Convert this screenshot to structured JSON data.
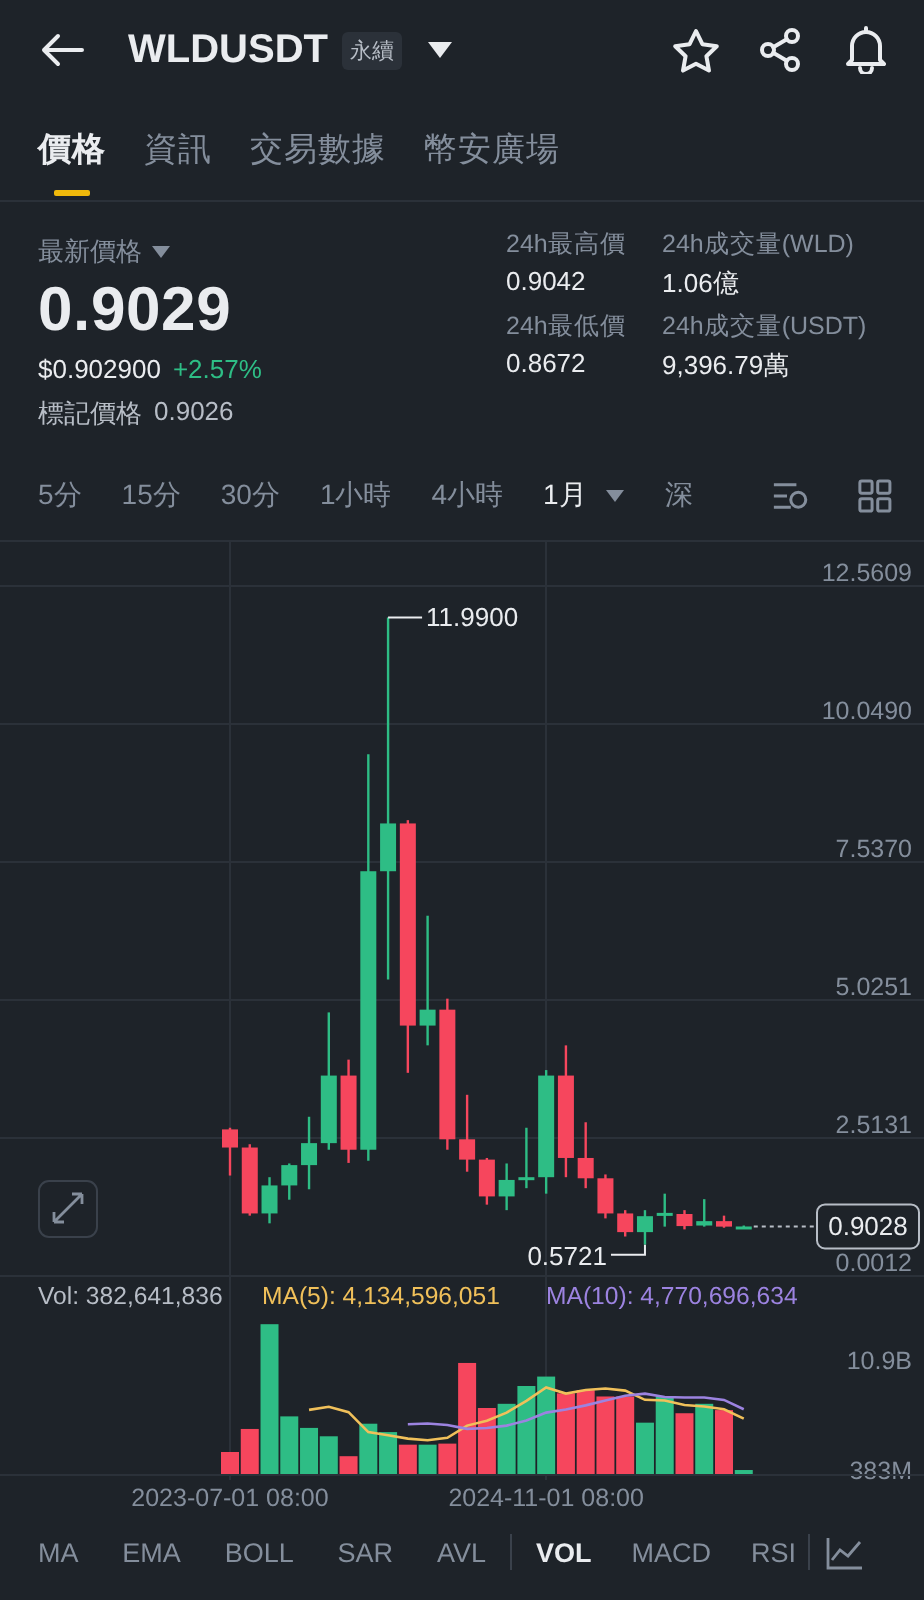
{
  "header": {
    "symbol": "WLDUSDT",
    "badge": "永續"
  },
  "tabs": [
    {
      "label": "價格",
      "selected": true
    },
    {
      "label": "資訊",
      "selected": false
    },
    {
      "label": "交易數據",
      "selected": false
    },
    {
      "label": "幣安廣場",
      "selected": false
    }
  ],
  "price": {
    "label": "最新價格",
    "last": "0.9029",
    "usd": "$0.902900",
    "change": "+2.57%",
    "rising": true,
    "mark_label": "標記價格",
    "mark": "0.9026"
  },
  "stats": [
    {
      "label": "24h最高價",
      "value": "0.9042"
    },
    {
      "label": "24h成交量(WLD)",
      "value": "1.06億"
    },
    {
      "label": "24h最低價",
      "value": "0.8672"
    },
    {
      "label": "24h成交量(USDT)",
      "value": "9,396.79萬"
    }
  ],
  "intervals": [
    {
      "label": "5分",
      "kind": "option",
      "selected": false
    },
    {
      "label": "15分",
      "kind": "option",
      "selected": false
    },
    {
      "label": "30分",
      "kind": "option",
      "selected": false
    },
    {
      "label": "1小時",
      "kind": "option",
      "selected": false
    },
    {
      "label": "4小時",
      "kind": "option",
      "selected": false
    },
    {
      "label": "1月",
      "kind": "dropdown",
      "selected": true
    },
    {
      "label": "深",
      "kind": "option",
      "selected": false
    }
  ],
  "price_chart": {
    "chart_data": {
      "type": "candlestick",
      "grid": true,
      "ylim": [
        0.0012,
        13.4
      ],
      "yticks": [
        {
          "value": 12.5609,
          "label": "12.5609"
        },
        {
          "value": 10.049,
          "label": "10.0490"
        },
        {
          "value": 7.537,
          "label": "7.5370"
        },
        {
          "value": 5.0251,
          "label": "5.0251"
        },
        {
          "value": 2.5131,
          "label": "2.5131"
        },
        {
          "value": 0.0012,
          "label": "0.0012"
        }
      ],
      "categories": [
        null,
        null,
        null,
        null,
        null,
        null,
        null,
        null,
        null,
        null,
        null,
        null,
        null,
        null,
        null,
        null,
        null,
        null,
        null,
        null,
        null,
        null,
        null,
        null,
        null,
        null,
        null
      ],
      "ohlc": [
        [
          2.67,
          2.7,
          1.83,
          2.34
        ],
        [
          2.34,
          2.4,
          1.1,
          1.14
        ],
        [
          1.14,
          1.8,
          0.96,
          1.65
        ],
        [
          1.65,
          2.05,
          1.39,
          2.02
        ],
        [
          2.02,
          2.9,
          1.58,
          2.42
        ],
        [
          2.42,
          4.8,
          2.3,
          3.65
        ],
        [
          3.65,
          3.94,
          2.06,
          2.3
        ],
        [
          2.3,
          9.5,
          2.1,
          7.37
        ],
        [
          7.37,
          11.99,
          5.4,
          8.24
        ],
        [
          8.24,
          8.3,
          3.7,
          4.56
        ],
        [
          4.56,
          6.56,
          4.2,
          4.85
        ],
        [
          4.85,
          5.05,
          2.3,
          2.49
        ],
        [
          2.49,
          3.3,
          1.9,
          2.12
        ],
        [
          2.12,
          2.15,
          1.3,
          1.45
        ],
        [
          1.45,
          2.05,
          1.2,
          1.75
        ],
        [
          1.75,
          2.7,
          1.6,
          1.8
        ],
        [
          1.8,
          3.75,
          1.5,
          3.65
        ],
        [
          3.65,
          4.2,
          1.8,
          2.15
        ],
        [
          2.15,
          2.8,
          1.6,
          1.78
        ],
        [
          1.78,
          1.85,
          1.05,
          1.14
        ],
        [
          1.14,
          1.2,
          0.72,
          0.8
        ],
        [
          0.8,
          1.2,
          0.5721,
          1.09
        ],
        [
          1.1,
          1.5,
          0.9,
          1.15
        ],
        [
          1.13,
          1.2,
          0.85,
          0.91
        ],
        [
          0.92,
          1.4,
          0.9,
          1.0
        ],
        [
          1.0,
          1.1,
          0.88,
          0.9
        ],
        [
          0.88,
          0.92,
          0.86,
          0.9028
        ]
      ],
      "annotations": [
        {
          "text": "11.9900"
        },
        {
          "text": "0.5721"
        }
      ],
      "ref_lines": [
        {
          "label": "0.9028"
        }
      ]
    }
  },
  "volume_chart": {
    "chart_data": {
      "type": "bar",
      "ylim": [
        0,
        18900000000
      ],
      "yticks": [
        {
          "value": 10900000000,
          "label": "10.9B"
        },
        {
          "value": 383000000,
          "label": "383M"
        }
      ],
      "categories": [
        "2023-07-01 08:00",
        null,
        null,
        null,
        null,
        null,
        null,
        null,
        null,
        null,
        null,
        null,
        null,
        null,
        null,
        null,
        "2024-11-01 08:00",
        null,
        null,
        null,
        null,
        null,
        null,
        null,
        null,
        null,
        null
      ],
      "series": [
        {
          "name": "Vol: 382,641,836",
          "colors": [
            "#f6465d",
            "#f6465d",
            "#2ebd85",
            "#2ebd85",
            "#2ebd85",
            "#2ebd85",
            "#f6465d",
            "#2ebd85",
            "#2ebd85",
            "#f6465d",
            "#2ebd85",
            "#f6465d",
            "#f6465d",
            "#f6465d",
            "#2ebd85",
            "#2ebd85",
            "#2ebd85",
            "#f6465d",
            "#f6465d",
            "#f6465d",
            "#f6465d",
            "#2ebd85",
            "#2ebd85",
            "#f6465d",
            "#2ebd85",
            "#f6465d",
            "#2ebd85"
          ],
          "values": [
            2100000000,
            4300000000,
            14300000000,
            5500000000,
            4400000000,
            3600000000,
            1700000000,
            4800000000,
            4000000000,
            2800000000,
            2800000000,
            2900000000,
            10600000000,
            6300000000,
            6700000000,
            8400000000,
            9300000000,
            7700000000,
            8000000000,
            7400000000,
            7400000000,
            4900000000,
            7400000000,
            5800000000,
            6700000000,
            6100000000,
            380000000
          ]
        },
        {
          "name": "MA(5): 4,134,596,051",
          "type": "line",
          "color": "#f0c05a",
          "values": [
            null,
            null,
            null,
            null,
            6120000000,
            6420000000,
            5900000000,
            4000000000,
            3700000000,
            3380000000,
            3220000000,
            3460000000,
            4620000000,
            5080000000,
            5860000000,
            6980000000,
            8260000000,
            7680000000,
            8020000000,
            8160000000,
            7960000000,
            7080000000,
            7020000000,
            6580000000,
            6440000000,
            6180000000,
            5280000000
          ]
        },
        {
          "name": "MA(10): 4,770,696,634",
          "type": "line",
          "color": "#9c83e0",
          "values": [
            null,
            null,
            null,
            null,
            null,
            null,
            null,
            null,
            null,
            4750000000,
            4820000000,
            4680000000,
            4310000000,
            4390000000,
            4620000000,
            5100000000,
            5860000000,
            6150000000,
            6550000000,
            7010000000,
            7470000000,
            7670000000,
            7350000000,
            7300000000,
            7300000000,
            7070000000,
            6180000000
          ]
        }
      ]
    }
  },
  "indicators": {
    "main": [
      {
        "label": "MA",
        "selected": false
      },
      {
        "label": "EMA",
        "selected": false
      },
      {
        "label": "BOLL",
        "selected": false
      },
      {
        "label": "SAR",
        "selected": false
      },
      {
        "label": "AVL",
        "selected": false
      }
    ],
    "sub": [
      {
        "label": "VOL",
        "selected": true
      },
      {
        "label": "MACD",
        "selected": false
      },
      {
        "label": "RSI",
        "selected": false
      }
    ]
  }
}
